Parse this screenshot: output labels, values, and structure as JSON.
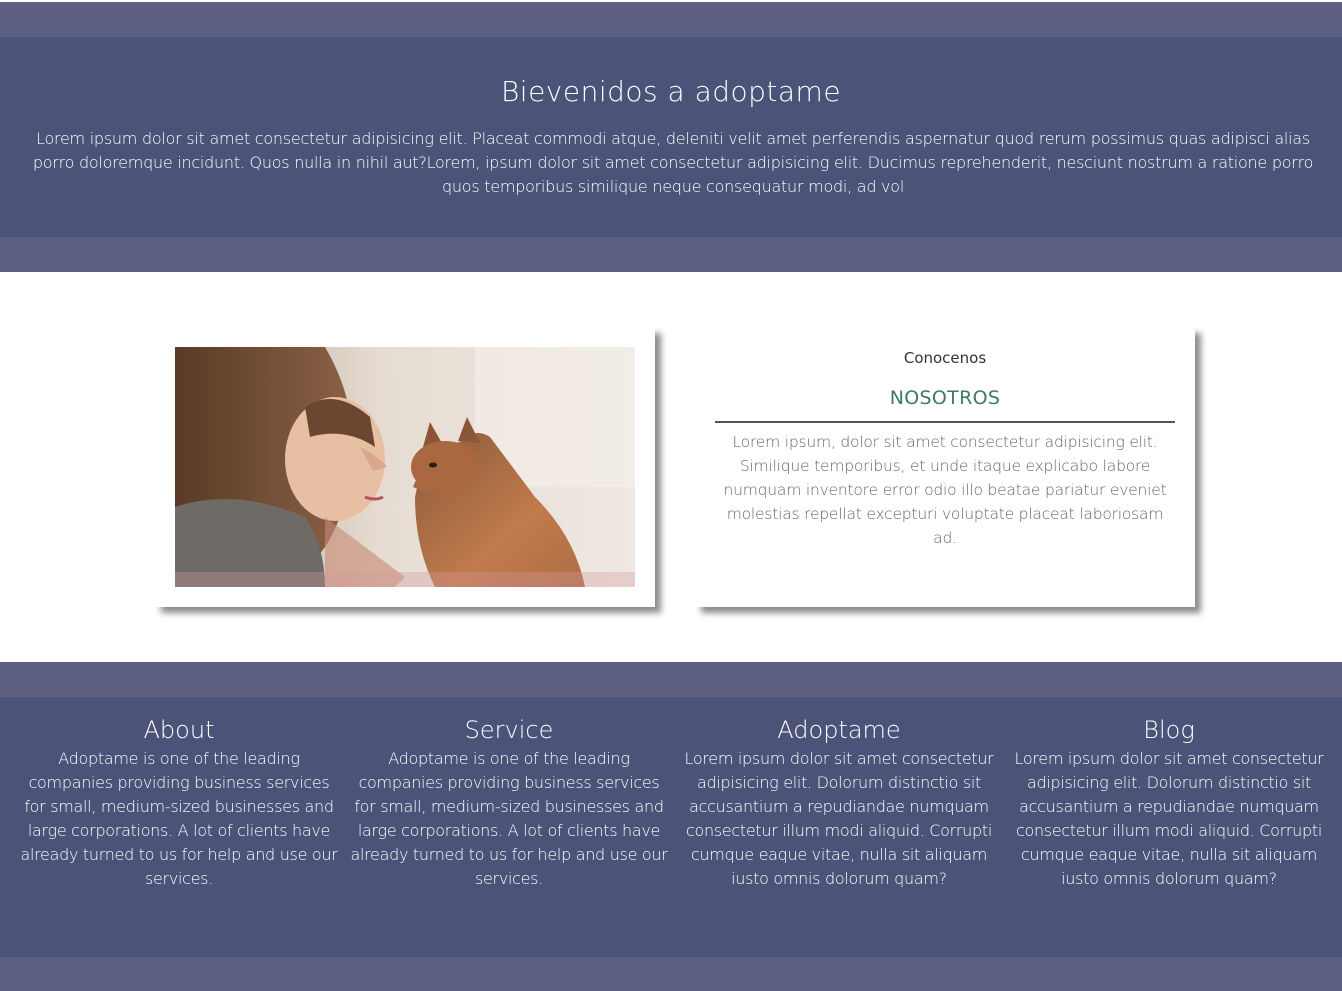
{
  "welcome": {
    "title": "Bievenidos a adoptame",
    "text": "Lorem ipsum dolor sit amet consectetur adipisicing elit. Placeat commodi atque, deleniti velit amet perferendis aspernatur quod rerum possimus quas adipisci alias porro doloremque incidunt. Quos nulla in nihil aut?Lorem, ipsum dolor sit amet consectetur adipisicing elit. Ducimus reprehenderit, nesciunt nostrum a ratione porro quos temporibus similique neque consequatur modi, ad vol"
  },
  "about_card": {
    "kicker": "Conocenos",
    "title": "NOSOTROS",
    "text": "Lorem ipsum, dolor sit amet consectetur adipisicing elit. Similique temporibus, et unde itaque explicabo labore numquam inventore error odio illo beatae pariatur eveniet molestias repellat excepturi voluptate placeat laboriosam ad."
  },
  "footer": {
    "columns": [
      {
        "title": "About",
        "text": "Adoptame is one of the leading companies providing business services for small, medium-sized businesses and large corporations. A lot of clients have already turned to us for help and use our services."
      },
      {
        "title": "Service",
        "text": "Adoptame is one of the leading companies providing business services for small, medium-sized businesses and large corporations. A lot of clients have already turned to us for help and use our services."
      },
      {
        "title": "Adoptame",
        "text": "Lorem ipsum dolor sit amet consectetur adipisicing elit. Dolorum distinctio sit accusantium a repudiandae numquam consectetur illum modi aliquid. Corrupti cumque eaque vitae, nulla sit aliquam iusto omnis dolorum quam?"
      },
      {
        "title": "Blog",
        "text": "Lorem ipsum dolor sit amet consectetur adipisicing elit. Dolorum distinctio sit accusantium a repudiandae numquam consectetur illum modi aliquid. Corrupti cumque eaque vitae, nulla sit aliquam iusto omnis dolorum quam?"
      }
    ]
  },
  "colors": {
    "band": "#5d6080",
    "panel": "#4b5378",
    "accent_green": "#3f7a62"
  }
}
